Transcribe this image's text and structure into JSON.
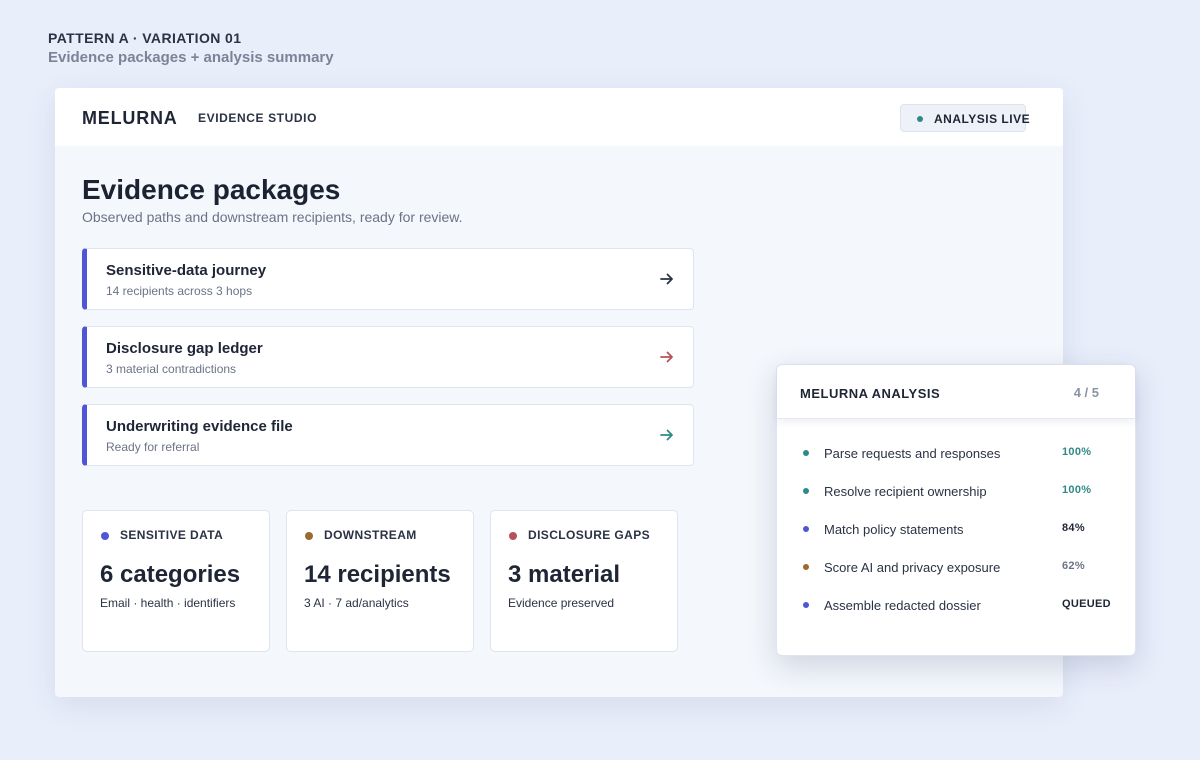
{
  "pattern": {
    "label": "PATTERN A · VARIATION 01",
    "subtitle": "Evidence packages + analysis summary"
  },
  "topbar": {
    "brand": "MELURNA",
    "section": "EVIDENCE STUDIO",
    "status_label": "ANALYSIS LIVE",
    "status_color": "#2f8a87"
  },
  "page": {
    "title": "Evidence packages",
    "description": "Observed paths and downstream recipients, ready for review."
  },
  "packages": [
    {
      "title": "Sensitive-data journey",
      "subtitle": "14 recipients across 3 hops",
      "arrow_color": "#2a3244",
      "icon": "arrow-right-icon"
    },
    {
      "title": "Disclosure gap ledger",
      "subtitle": "3 material contradictions",
      "arrow_color": "#b5535b",
      "icon": "arrow-right-icon"
    },
    {
      "title": "Underwriting evidence file",
      "subtitle": "Ready for referral",
      "arrow_color": "#2f8a87",
      "icon": "arrow-right-icon"
    }
  ],
  "accent_color": "#4f56d6",
  "stats": [
    {
      "label": "SENSITIVE DATA",
      "value": "6 categories",
      "note": "Email · health · identifiers",
      "color": "#4f56d6"
    },
    {
      "label": "DOWNSTREAM",
      "value": "14 recipients",
      "note": "3 AI · 7 ad/analytics",
      "color": "#9a6a2f"
    },
    {
      "label": "DISCLOSURE GAPS",
      "value": "3 material",
      "note": "Evidence preserved",
      "color": "#b5535b"
    }
  ],
  "analysis": {
    "title": "MELURNA ANALYSIS",
    "count": "4 / 5",
    "steps": [
      {
        "label": "Parse requests and responses",
        "status": "100%",
        "dot_color": "#2f8a87",
        "status_color": "#2f8a87"
      },
      {
        "label": "Resolve recipient ownership",
        "status": "100%",
        "dot_color": "#2f8a87",
        "status_color": "#2f8a87"
      },
      {
        "label": "Match policy statements",
        "status": "84%",
        "dot_color": "#4f56d6",
        "status_color": "#1e2535"
      },
      {
        "label": "Score AI and privacy exposure",
        "status": "62%",
        "dot_color": "#9a6a2f",
        "status_color": "#6b7385"
      },
      {
        "label": "Assemble redacted dossier",
        "status": "QUEUED",
        "dot_color": "#4f56d6",
        "status_color": "#1e2535"
      }
    ]
  }
}
